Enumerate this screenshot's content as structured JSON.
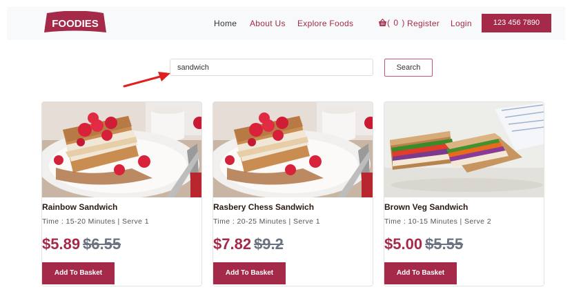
{
  "brand": {
    "logo_text": "FOODIES",
    "accent": "#a52a4a"
  },
  "nav": {
    "home": "Home",
    "about": "About Us",
    "explore": "Explore Foods",
    "cart_count": "( 0 )",
    "register": "Register",
    "login": "Login",
    "phone": "123 456 7890"
  },
  "search": {
    "value": "sandwich",
    "button": "Search"
  },
  "products": [
    {
      "name": "Rainbow Sandwich",
      "meta": "Time : 15-20 Minutes | Serve 1",
      "price": "$5.89",
      "old_price": "$6.55",
      "button": "Add To Basket",
      "image": "french-toast-raspberries"
    },
    {
      "name": "Rasbery Chess Sandwich",
      "meta": "Time : 20-25 Minutes | Serve 1",
      "price": "$7.82",
      "old_price": "$9.2",
      "button": "Add To Basket",
      "image": "french-toast-raspberries"
    },
    {
      "name": "Brown Veg Sandwich",
      "meta": "Time : 10-15 Minutes | Serve 2",
      "price": "$5.00",
      "old_price": "$5.55",
      "button": "Add To Basket",
      "image": "veg-sandwich"
    }
  ]
}
